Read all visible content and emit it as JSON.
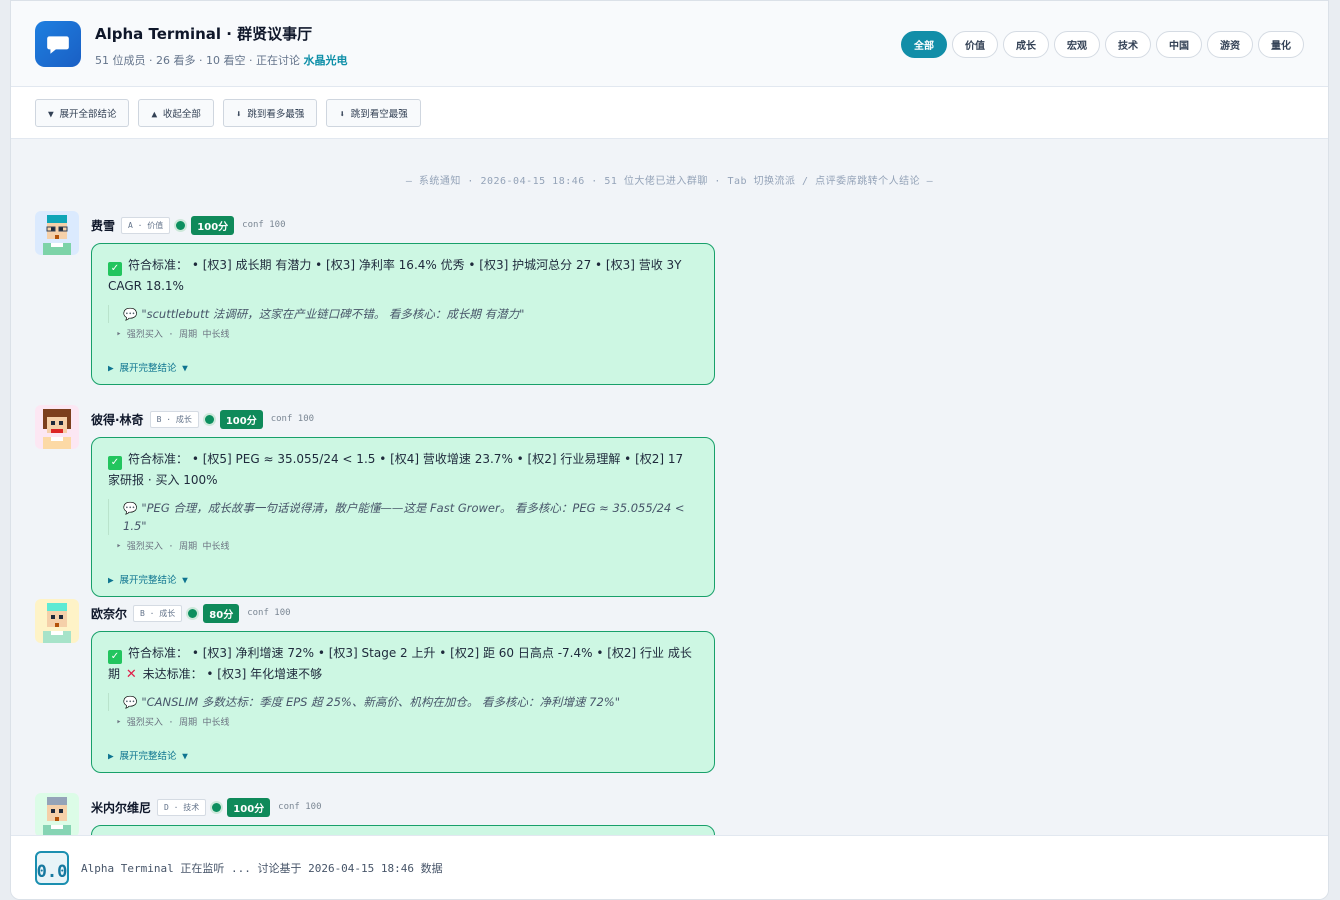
{
  "header": {
    "title": "Alpha Terminal · 群贤议事厅",
    "subtitle_prefix": "51 位成员 · 26 看多 · 10 看空 · 正在讨论 ",
    "topic": "水晶光电",
    "filters": [
      "全部",
      "价值",
      "成长",
      "宏观",
      "技术",
      "中国",
      "游资",
      "量化"
    ]
  },
  "toolbar": {
    "expand_all": "▼  展开全部结论",
    "collapse_all": "▲  收起全部",
    "jump_bull": "⬇  跳到看多最强",
    "jump_bear": "⬇  跳到看空最强"
  },
  "system_note": "— 系统通知 · 2026-04-15 18:46 · 51 位大佬已进入群聊 · Tab 切换流派 / 点评委席跳转个人结论 —",
  "messages": [
    {
      "name": "费雪",
      "tag": "A · 价值",
      "score": "100分",
      "conf": "conf 100",
      "verdict": "符合标准：  • [权3] 成长期 有潜力 • [权3] 净利率 16.4% 优秀 • [权3] 护城河总分 27 • [权3] 营收 3Y CAGR 18.1%",
      "quote": "\"scuttlebutt 法调研，这家在产业链口碑不错。 看多核心：成长期 有潜力\"",
      "action": "‣  强烈买入  ·  周期  中长线",
      "expand": "▶ 展开完整结论  ▼"
    },
    {
      "name": "彼得·林奇",
      "tag": "B · 成长",
      "score": "100分",
      "conf": "conf 100",
      "verdict": "符合标准：  • [权5] PEG ≈ 35.055/24 < 1.5 • [权4] 营收增速 23.7% • [权2] 行业易理解 • [权2] 17 家研报 · 买入 100%",
      "quote": "\"PEG 合理，成长故事一句话说得清，散户能懂——这是 Fast Grower。 看多核心：PEG ≈ 35.055/24 < 1.5\"",
      "action": "‣  强烈买入  ·  周期  中长线",
      "expand": "▶ 展开完整结论  ▼"
    },
    {
      "name": "欧奈尔",
      "tag": "B · 成长",
      "score": "80分",
      "conf": "conf 100",
      "verdict_a": "符合标准：  • [权3] 净利增速 72% • [权3] Stage 2 上升 • [权2] 距 60 日高点 -7.4% • [权2] 行业 成长期",
      "verdict_b": "未达标准：  • [权3] 年化增速不够",
      "quote": "\"CANSLIM 多数达标：季度 EPS 超 25%、新高价、机构在加仓。 看多核心：净利增速 72%\"",
      "action": "‣  强烈买入  ·  周期  中长线",
      "expand": "▶ 展开完整结论  ▼"
    },
    {
      "name": "米内尔维尼",
      "tag": "D · 技术",
      "score": "100分",
      "conf": "conf 100"
    }
  ],
  "footer": {
    "logo": "0.0",
    "text": "Alpha Terminal 正在监听 ...  讨论基于 2026-04-15 18:46 数据"
  },
  "colors": {
    "accent": "#128ea8",
    "bull_bg": "#cdf7e3",
    "bull_border": "#18a06a",
    "score": "#0f8a5a"
  }
}
